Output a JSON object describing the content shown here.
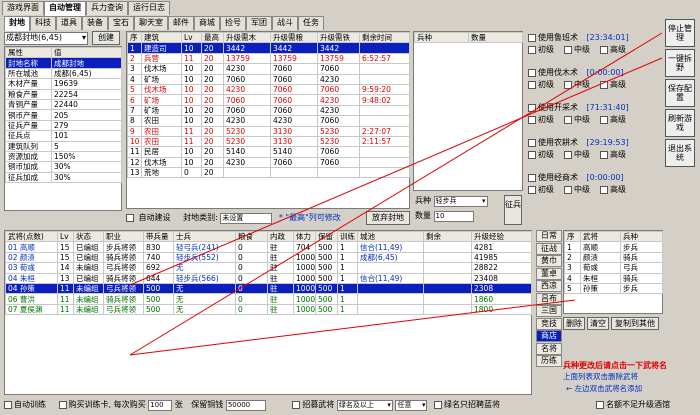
{
  "top_tabs": [
    "游戏界面",
    "自动管理",
    "兵力查询",
    "运行日志"
  ],
  "sub_tabs": [
    "封地",
    "科技",
    "道具",
    "装备",
    "宝石",
    "聊天室",
    "邮件",
    "商城",
    "捡号",
    "军团",
    "战斗",
    "任务"
  ],
  "city_selector": "成都封地(6,45)",
  "create_button": "创建",
  "attr_table": {
    "headers": [
      "属性",
      "值"
    ],
    "rows": [
      [
        "封地名称",
        "成都封地"
      ],
      [
        "所在城池",
        "成都(6,45)"
      ],
      [
        "木材产量",
        "19639"
      ],
      [
        "粮食产量",
        "22254"
      ],
      [
        "青铜产量",
        "22440"
      ],
      [
        "铜币产量",
        "205"
      ],
      [
        "征兵产量",
        "279"
      ],
      [
        "征兵点",
        "101"
      ],
      [
        "建筑队列",
        "5"
      ],
      [
        "资源加成",
        "150%"
      ],
      [
        "铜币加成",
        "30%"
      ],
      [
        "征兵加成",
        "30%"
      ]
    ]
  },
  "building_table": {
    "headers": [
      "序",
      "建筑",
      "Lv",
      "最高",
      "升级需木",
      "升级需粮",
      "升级需铁",
      "剩余时间"
    ],
    "rows": [
      {
        "cells": [
          "1",
          "建造司",
          "10",
          "20",
          "3442",
          "3442",
          "3442",
          ""
        ],
        "selected": true
      },
      {
        "cells": [
          "2",
          "兵营",
          "11",
          "20",
          "13759",
          "13759",
          "13759",
          "6:52:57"
        ],
        "red": true
      },
      {
        "cells": [
          "3",
          "伐木场",
          "10",
          "20",
          "4230",
          "7060",
          "7060",
          ""
        ]
      },
      {
        "cells": [
          "4",
          "矿场",
          "10",
          "20",
          "7060",
          "7060",
          "4230",
          ""
        ]
      },
      {
        "cells": [
          "5",
          "伐木场",
          "10",
          "20",
          "4230",
          "7060",
          "7060",
          "9:59:20"
        ],
        "red": true
      },
      {
        "cells": [
          "6",
          "矿场",
          "10",
          "20",
          "7060",
          "7060",
          "4230",
          "9:48:02"
        ],
        "red": true
      },
      {
        "cells": [
          "7",
          "矿场",
          "10",
          "20",
          "7060",
          "7060",
          "4230",
          ""
        ]
      },
      {
        "cells": [
          "8",
          "农田",
          "10",
          "20",
          "4230",
          "4230",
          "7060",
          ""
        ]
      },
      {
        "cells": [
          "9",
          "农田",
          "11",
          "20",
          "5230",
          "3130",
          "5230",
          "2:27:07"
        ],
        "red": true
      },
      {
        "cells": [
          "10",
          "农田",
          "11",
          "20",
          "5230",
          "3130",
          "5230",
          "2:11:57"
        ],
        "red": true
      },
      {
        "cells": [
          "11",
          "民居",
          "10",
          "20",
          "5140",
          "5140",
          "7060",
          ""
        ]
      },
      {
        "cells": [
          "12",
          "伐木场",
          "10",
          "20",
          "4230",
          "7060",
          "7060",
          ""
        ]
      },
      {
        "cells": [
          "13",
          "荒地",
          "0",
          "20",
          "",
          "",
          "",
          ""
        ]
      }
    ]
  },
  "auto_build": {
    "label": "自动建设",
    "type_label": "封地类别:",
    "type_value": "未设置",
    "hint": "* \"最高\"列可修改",
    "abandon_button": "放弃封地"
  },
  "soldier_table": {
    "headers": [
      "兵种",
      "数量"
    ]
  },
  "soldier_controls": {
    "type_label": "兵种",
    "type_value": "轻步兵",
    "count_label": "数量",
    "count_value": "10",
    "recruit_button": "征兵"
  },
  "tech_rows": [
    {
      "label": "使用鲁班术",
      "timer": "[23:34:01]"
    },
    {
      "label": "使用伐木术",
      "timer": "[0:00:00]"
    },
    {
      "label": "使用开采术",
      "timer": "[71:31:40]"
    },
    {
      "label": "使用农耕术",
      "timer": "[29:19:53]"
    },
    {
      "label": "使用经商术",
      "timer": "[0:00:00]"
    }
  ],
  "levels": [
    "初级",
    "中级",
    "高级"
  ],
  "side_buttons": [
    "停止管理",
    "一键拆野",
    "保存配置",
    "刷新游戏",
    "退出系统"
  ],
  "general_table": {
    "headers": [
      "武将(点数)",
      "Lv",
      "状态",
      "职业",
      "带兵量",
      "士兵",
      "粮食",
      "内政",
      "体力",
      "保留",
      "训练",
      "城池",
      "剩余",
      "升级经验"
    ],
    "rows": [
      {
        "cells": [
          "01 高顺",
          "15",
          "已编组",
          "步兵将领",
          "830",
          "轻弓兵(241)",
          "0",
          "驻",
          "704",
          "500",
          "1",
          "信合(11,49)",
          "",
          "4281"
        ]
      },
      {
        "cells": [
          "02 颜渍",
          "15",
          "已编组",
          "骑兵将领",
          "740",
          "轻步兵(552)",
          "0",
          "驻",
          "1000",
          "500",
          "1",
          "成都(6,45)",
          "",
          "41985"
        ]
      },
      {
        "cells": [
          "03 荀彧",
          "14",
          "未编组",
          "弓兵将领",
          "692",
          "无",
          "0",
          "驻",
          "1000",
          "500",
          "1",
          "",
          "",
          "28822"
        ]
      },
      {
        "cells": [
          "04 朱桓",
          "13",
          "已编组",
          "骑兵将领",
          "644",
          "轻步兵(566)",
          "0",
          "驻",
          "1000",
          "500",
          "1",
          "信合(11,49)",
          "",
          "23408"
        ]
      },
      {
        "cells": [
          "04 孙策",
          "11",
          "未编组",
          "弓兵将领",
          "500",
          "无",
          "0",
          "驻",
          "1000",
          "500",
          "1",
          "",
          "",
          "2308"
        ],
        "selected": true
      },
      {
        "cells": [
          "06 曹洪",
          "11",
          "未编组",
          "骑兵将领",
          "500",
          "无",
          "0",
          "驻",
          "1000",
          "500",
          "1",
          "",
          "",
          "1860"
        ],
        "green": true
      },
      {
        "cells": [
          "07 夏侯渊",
          "11",
          "未编组",
          "弓兵将领",
          "500",
          "无",
          "0",
          "驻",
          "1000",
          "500",
          "1",
          "",
          "",
          "1800"
        ],
        "green": true
      }
    ]
  },
  "vertical_tabs": [
    "日常",
    "征战",
    "黄巾",
    "董卓",
    "西凉",
    "吕布",
    "三国",
    "竞技",
    "商店",
    "名将",
    "历练"
  ],
  "selected_vtab": 8,
  "roster_table": {
    "headers": [
      "序",
      "武将",
      "兵种"
    ],
    "rows": [
      [
        "1",
        "高顺",
        "步兵"
      ],
      [
        "2",
        "颜渍",
        "骑兵"
      ],
      [
        "3",
        "荀彧",
        "弓兵"
      ],
      [
        "4",
        "朱桓",
        "骑兵"
      ],
      [
        "5",
        "孙策",
        "步兵"
      ]
    ]
  },
  "roster_buttons": [
    "删除",
    "清空",
    "复制到其他"
  ],
  "notes": {
    "line1": "兵种更改后请点击一下武将名",
    "line2": "上面列表双击删除武将",
    "line3": "← 左边双击武将名添加"
  },
  "bottom_bar": {
    "auto_train": "自动训练",
    "buy_train": "购买训练卡, 每次购买",
    "buy_count": "100",
    "buy_unit": "张",
    "reserve_label": "保留铜钱",
    "reserve_value": "50000",
    "recruit_general": "招募武将",
    "recruit_select": "绿名及以上",
    "recruit_any": "任意",
    "green_recruit": "绿名只招聘蓝将",
    "no_upgrade": "名额不足升级酒馆"
  }
}
